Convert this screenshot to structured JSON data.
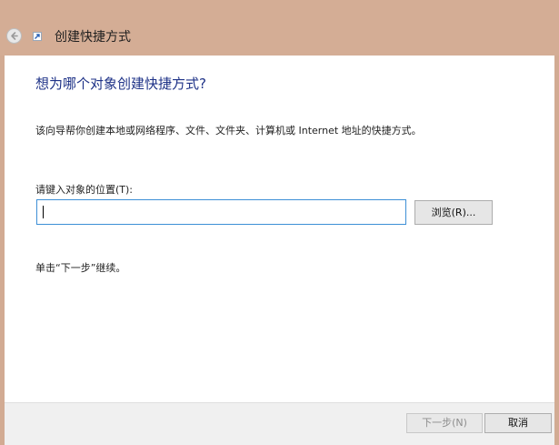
{
  "window": {
    "title": "创建快捷方式",
    "icons": {
      "back": "back-arrow-icon",
      "app": "shortcut-icon"
    }
  },
  "content": {
    "heading": "想为哪个对象创建快捷方式?",
    "description": "该向导帮你创建本地或网络程序、文件、文件夹、计算机或 Internet 地址的快捷方式。",
    "location_label": "请键入对象的位置(T):",
    "location_value": "",
    "browse_label": "浏览(R)...",
    "hint": "单击“下一步”继续。"
  },
  "footer": {
    "next_label": "下一步(N)",
    "cancel_label": "取消"
  },
  "colors": {
    "title_bar": "#d4ad95",
    "heading": "#1e3287",
    "input_border": "#3d8fd6",
    "footer": "#f0f0f0"
  }
}
